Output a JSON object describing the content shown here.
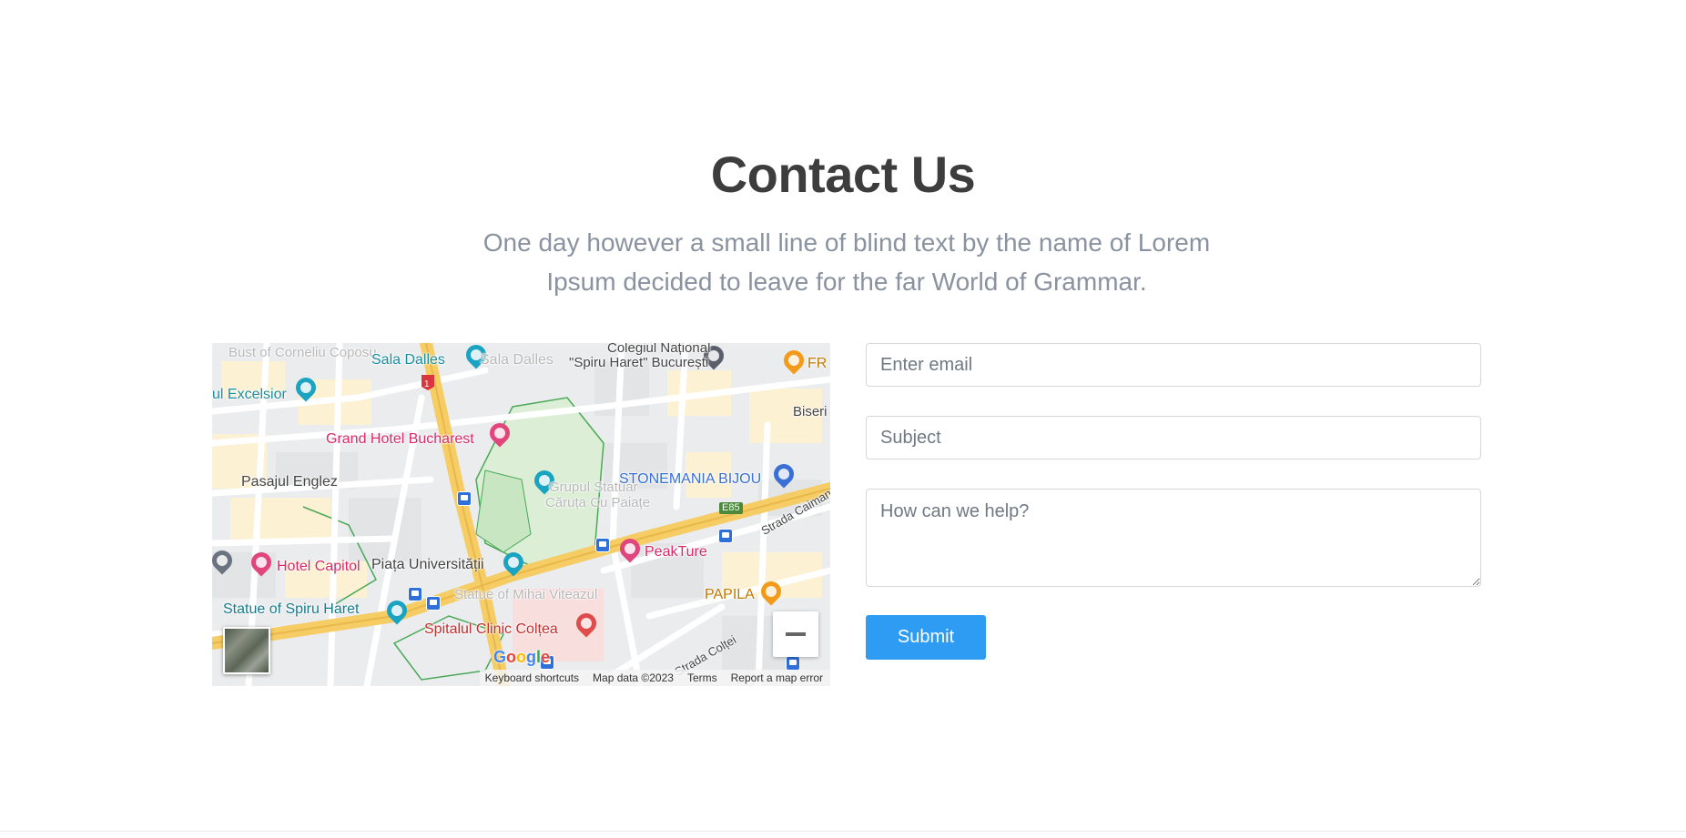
{
  "section": {
    "title": "Contact Us",
    "subtitle": "One day however a small line of blind text by the name of Lorem Ipsum decided to leave for the far World of Grammar."
  },
  "map": {
    "place_labels": {
      "sala_dalles": "Sala Dalles",
      "sala_dalles_faded": "Sala Dalles",
      "bust": "Bust of Corneliu Coposu",
      "excelsior": "ul Excelsior",
      "colegiul_line1": "Colegiul Național",
      "colegiul_line2": "\"Spiru Haret\" București",
      "fr": "FR",
      "biseri": "Biseri",
      "grand_hotel": "Grand Hotel Bucharest",
      "pasajul": "Pasajul Englez",
      "grupul_line1": "Grupul Statuar",
      "grupul_line2": "Căruța Cu Paiațe",
      "stonemania": "STONEMANIA BIJOU",
      "e85": "E85",
      "strada_caiman": "Strada Caiman",
      "hotel_capitol": "Hotel Capitol",
      "piata": "Piața Universității",
      "peakture": "PeakTure",
      "papila": "PAPILA",
      "statue_mihai": "Statue of Mihai Viteazul",
      "statue_spiru": "Statue of Spiru Haret",
      "spitalul": "Spitalul Clinic Colțea",
      "strada_coltei": "Strada Colței",
      "road_1": "1"
    },
    "google_logo": "Google",
    "footer": {
      "keyboard": "Keyboard shortcuts",
      "map_data": "Map data ©2023",
      "terms": "Terms",
      "report": "Report a map error"
    },
    "colors": {
      "major_road": "#f6cc65",
      "minor_road": "#ffffff",
      "park": "#c8e6c2",
      "park_outline": "#4aa857",
      "block_warm": "#fdf1d4",
      "block_grey": "#e6e7e9"
    }
  },
  "form": {
    "email_placeholder": "Enter email",
    "subject_placeholder": "Subject",
    "message_placeholder": "How can we help?",
    "submit_label": "Submit",
    "submit_color": "#2f9cf4"
  }
}
